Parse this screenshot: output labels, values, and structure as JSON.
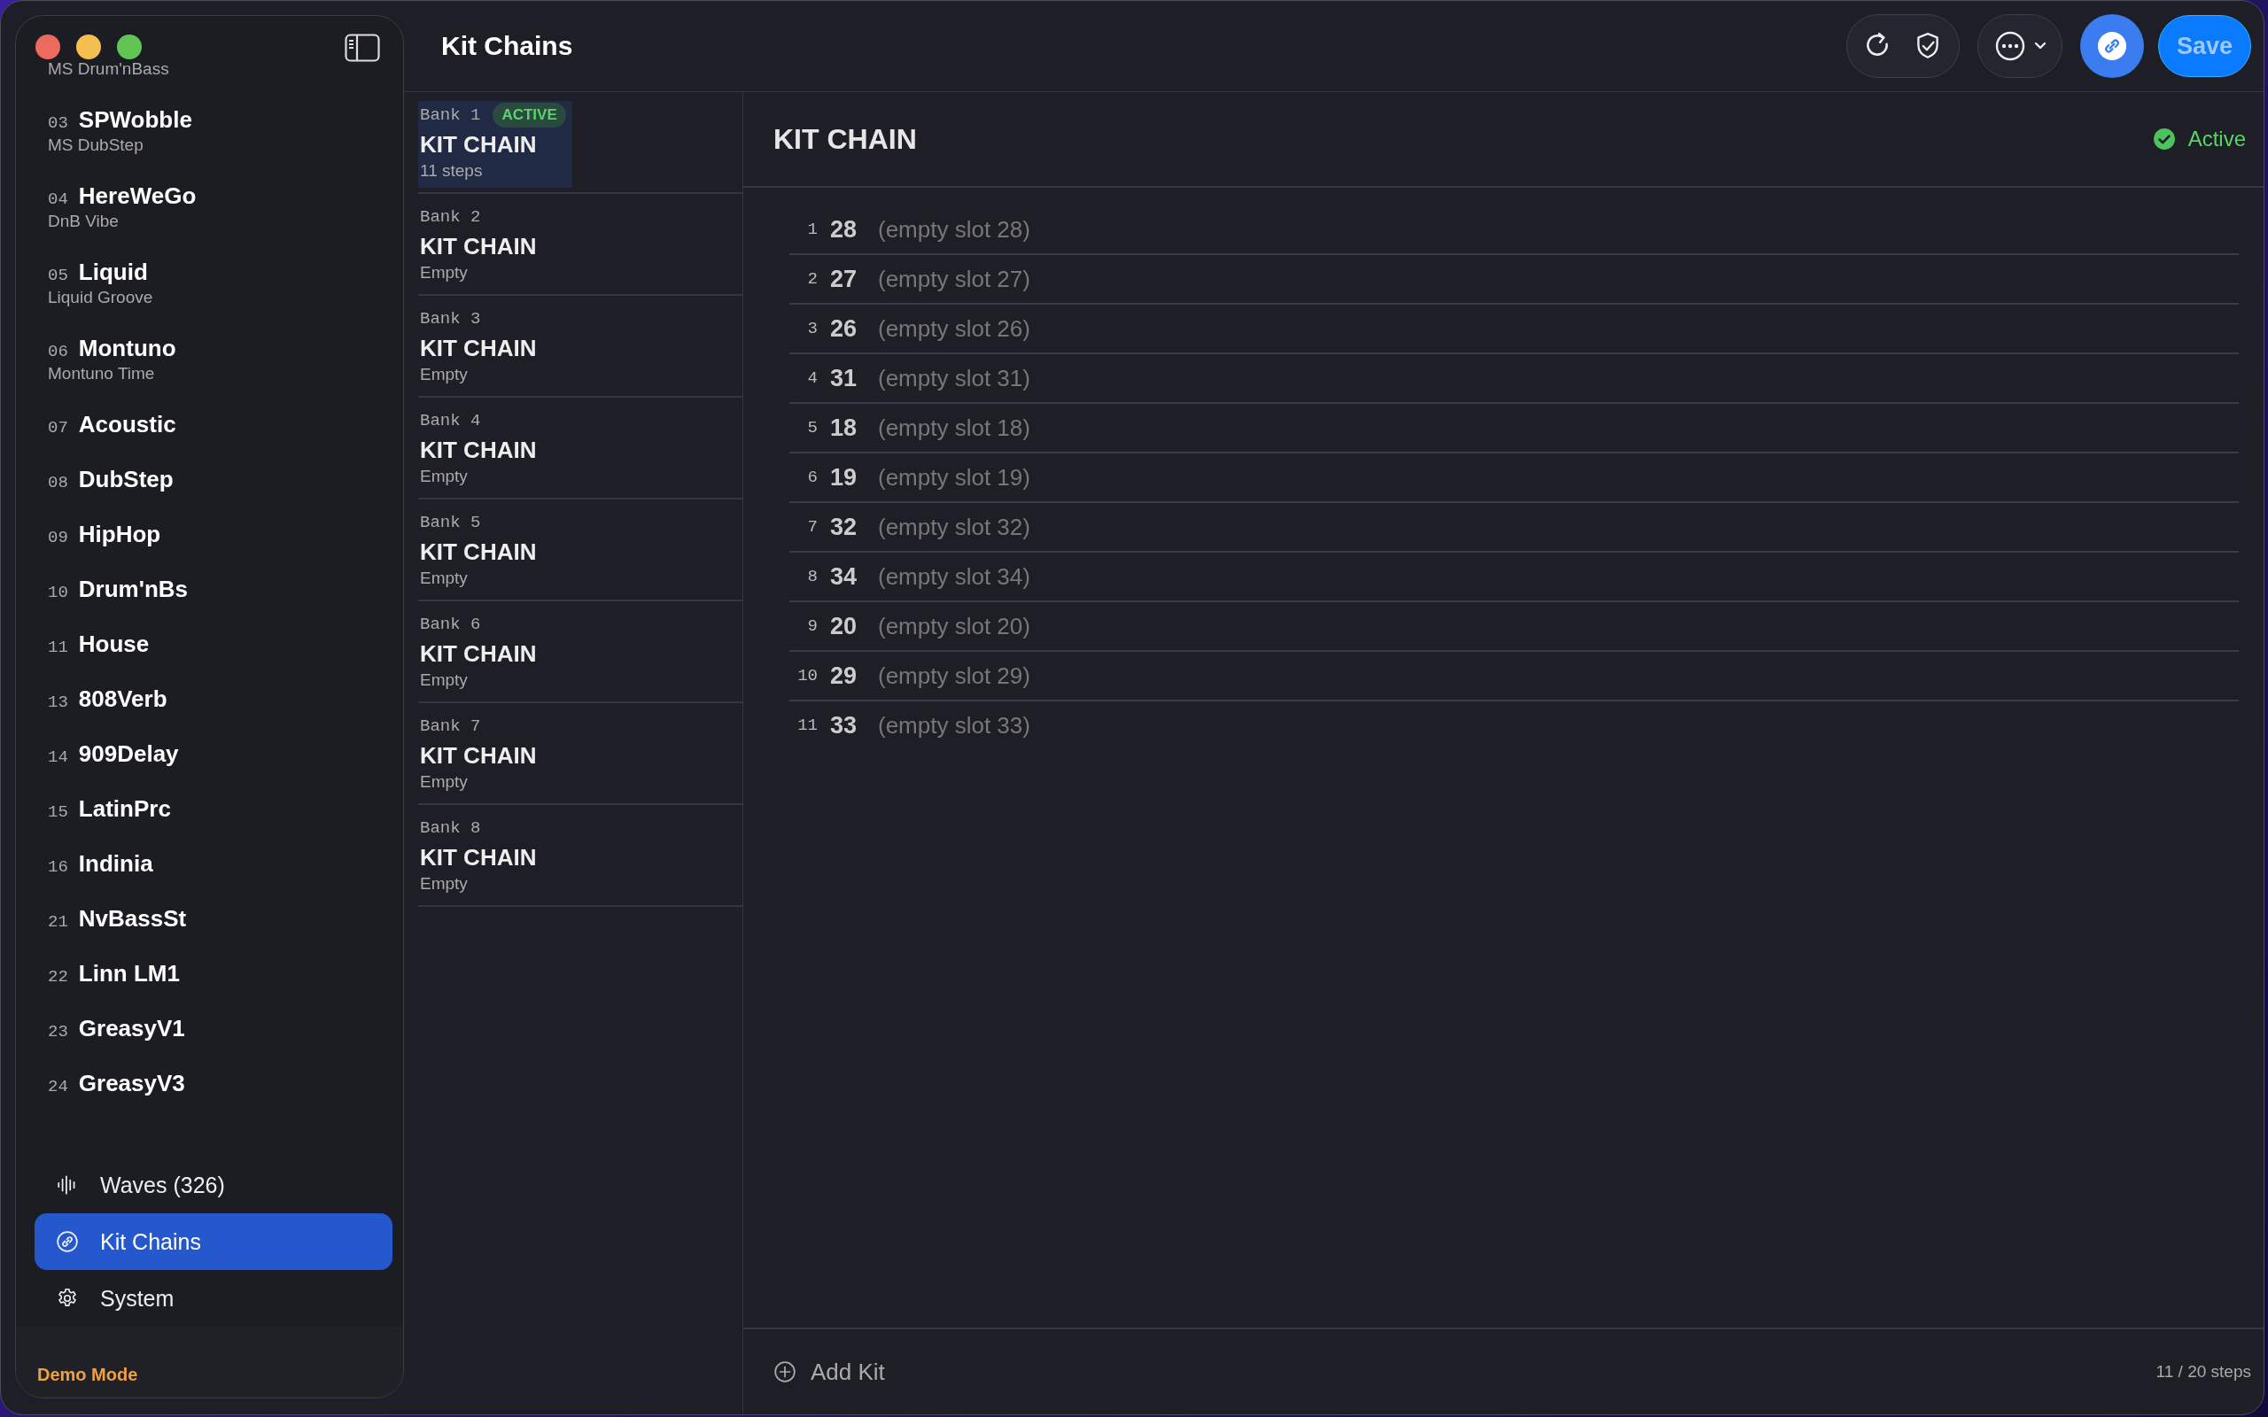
{
  "window": {
    "title": "Kit Chains"
  },
  "sidebar": {
    "kits": [
      {
        "subtitle": "MS Drum'nBass"
      },
      {
        "number": "03",
        "name": "SPWobble",
        "subtitle": "MS DubStep"
      },
      {
        "number": "04",
        "name": "HereWeGo",
        "subtitle": "DnB Vibe"
      },
      {
        "number": "05",
        "name": "Liquid",
        "subtitle": "Liquid Groove"
      },
      {
        "number": "06",
        "name": "Montuno",
        "subtitle": "Montuno Time"
      },
      {
        "number": "07",
        "name": "Acoustic"
      },
      {
        "number": "08",
        "name": "DubStep"
      },
      {
        "number": "09",
        "name": "HipHop"
      },
      {
        "number": "10",
        "name": "Drum'nBs"
      },
      {
        "number": "11",
        "name": "House"
      },
      {
        "number": "13",
        "name": "808Verb"
      },
      {
        "number": "14",
        "name": "909Delay"
      },
      {
        "number": "15",
        "name": "LatinPrc"
      },
      {
        "number": "16",
        "name": "Indinia"
      },
      {
        "number": "21",
        "name": "NvBassSt"
      },
      {
        "number": "22",
        "name": "Linn LM1"
      },
      {
        "number": "23",
        "name": "GreasyV1"
      },
      {
        "number": "24",
        "name": "GreasyV3"
      }
    ],
    "nav": [
      {
        "label": "Waves (326)",
        "kind": "waves",
        "selected": false
      },
      {
        "label": "Kit Chains",
        "kind": "chain",
        "selected": true
      },
      {
        "label": "System",
        "kind": "gear",
        "selected": false
      }
    ],
    "footer": "Demo Mode"
  },
  "toolbar": {
    "save": "Save"
  },
  "banks": [
    {
      "label": "Bank 1",
      "badge": "ACTIVE",
      "title": "KIT CHAIN",
      "subtitle": "11 steps",
      "selected": true
    },
    {
      "label": "Bank 2",
      "title": "KIT CHAIN",
      "subtitle": "Empty",
      "selected": false
    },
    {
      "label": "Bank 3",
      "title": "KIT CHAIN",
      "subtitle": "Empty",
      "selected": false
    },
    {
      "label": "Bank 4",
      "title": "KIT CHAIN",
      "subtitle": "Empty",
      "selected": false
    },
    {
      "label": "Bank 5",
      "title": "KIT CHAIN",
      "subtitle": "Empty",
      "selected": false
    },
    {
      "label": "Bank 6",
      "title": "KIT CHAIN",
      "subtitle": "Empty",
      "selected": false
    },
    {
      "label": "Bank 7",
      "title": "KIT CHAIN",
      "subtitle": "Empty",
      "selected": false
    },
    {
      "label": "Bank 8",
      "title": "KIT CHAIN",
      "subtitle": "Empty",
      "selected": false
    }
  ],
  "detail": {
    "title": "KIT CHAIN",
    "status": "Active",
    "steps": [
      {
        "index": "1",
        "kit": "28",
        "name": "(empty slot 28)"
      },
      {
        "index": "2",
        "kit": "27",
        "name": "(empty slot 27)"
      },
      {
        "index": "3",
        "kit": "26",
        "name": "(empty slot 26)"
      },
      {
        "index": "4",
        "kit": "31",
        "name": "(empty slot 31)"
      },
      {
        "index": "5",
        "kit": "18",
        "name": "(empty slot 18)"
      },
      {
        "index": "6",
        "kit": "19",
        "name": "(empty slot 19)"
      },
      {
        "index": "7",
        "kit": "32",
        "name": "(empty slot 32)"
      },
      {
        "index": "8",
        "kit": "34",
        "name": "(empty slot 34)"
      },
      {
        "index": "9",
        "kit": "20",
        "name": "(empty slot 20)"
      },
      {
        "index": "10",
        "kit": "29",
        "name": "(empty slot 29)"
      },
      {
        "index": "11",
        "kit": "33",
        "name": "(empty slot 33)"
      }
    ],
    "add_label": "Add Kit",
    "count": "11 / 20 steps"
  }
}
